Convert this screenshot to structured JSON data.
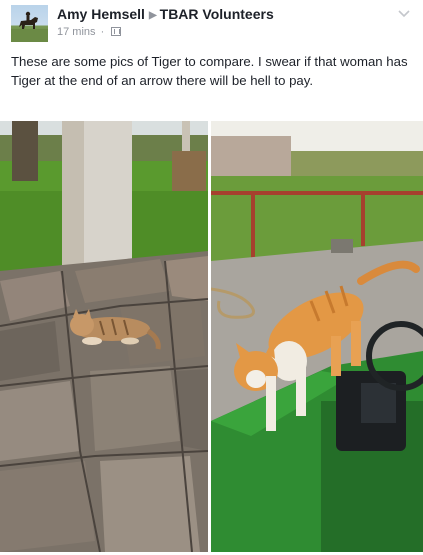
{
  "post": {
    "author": "Amy Hemsell",
    "group": "TBAR Volunteers",
    "time": "17 mins",
    "separator": "·",
    "text": "These are some pics of Tiger to compare. I swear if that woman has Tiger at the end of an arrow there will be hell to pay."
  },
  "icons": {
    "share_target": "right-triangle-icon",
    "audience": "group-audience-icon",
    "options": "chevron-down-icon",
    "avatar": "horse-rider-avatar"
  },
  "photos": [
    {
      "subject": "orange tabby cat lying on flagstone porch"
    },
    {
      "subject": "orange and white cat standing on green utility vehicle"
    }
  ],
  "colors": {
    "name_text": "#1d2129",
    "meta_text": "#90949c",
    "background": "#ffffff"
  }
}
